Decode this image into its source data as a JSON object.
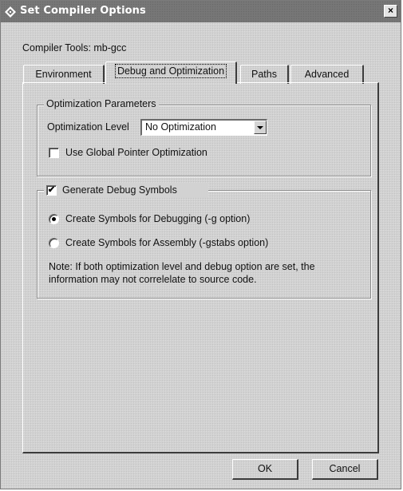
{
  "window": {
    "title": "Set Compiler Options",
    "close_label": "×"
  },
  "compiler_tools": "Compiler Tools: mb-gcc",
  "tabs": [
    {
      "label": "Environment",
      "active": false
    },
    {
      "label": "Debug and Optimization",
      "active": true
    },
    {
      "label": "Paths",
      "active": false
    },
    {
      "label": "Advanced",
      "active": false
    }
  ],
  "optimization": {
    "legend": "Optimization Parameters",
    "level_label": "Optimization Level",
    "level_value": "No Optimization",
    "global_pointer_label": "Use Global Pointer Optimization",
    "global_pointer_checked": false
  },
  "debug": {
    "legend": "Generate Debug Symbols",
    "generate_checked": true,
    "check_mark": "✔",
    "radio_debugging": "Create Symbols for Debugging (-g option)",
    "radio_assembly": "Create Symbols for Assembly (-gstabs option)",
    "selected": "debugging",
    "note_line1": "Note: If both optimization level and debug option are set, the",
    "note_line2": "information may not correlelate to source code."
  },
  "buttons": {
    "ok": "OK",
    "cancel": "Cancel"
  },
  "icons": {
    "app": "compiler-app-icon",
    "close": "close-icon",
    "dropdown": "chevron-down-icon"
  }
}
